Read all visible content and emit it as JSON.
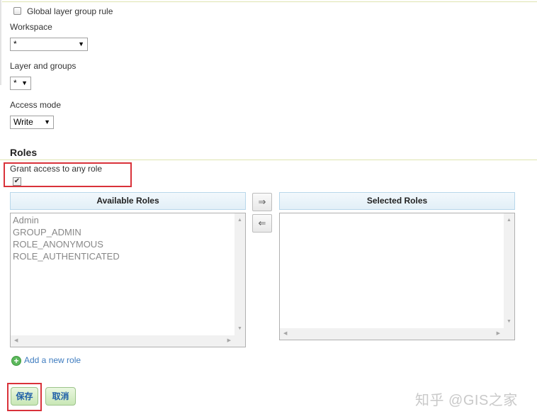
{
  "form": {
    "global_layer_group_rule_label": "Global layer group rule",
    "global_layer_group_rule_checked": false,
    "workspace_label": "Workspace",
    "workspace_value": "*",
    "layer_groups_label": "Layer and groups",
    "layer_groups_value": "*",
    "access_mode_label": "Access mode",
    "access_mode_value": "Write"
  },
  "roles": {
    "heading": "Roles",
    "grant_any_label": "Grant access to any role",
    "grant_any_checked": true,
    "available_header": "Available Roles",
    "selected_header": "Selected Roles",
    "available": [
      "Admin",
      "GROUP_ADMIN",
      "ROLE_ANONYMOUS",
      "ROLE_AUTHENTICATED"
    ],
    "selected": [],
    "move_right_glyph": "⇒",
    "move_left_glyph": "⇐",
    "add_role_label": "Add a new role"
  },
  "actions": {
    "save_label": "保存",
    "cancel_label": "取消"
  },
  "watermark": "知乎 @GIS之家",
  "colors": {
    "highlight_red": "#d9323a",
    "link_blue": "#3d7bbf",
    "button_green": "#c9e7b6",
    "header_blue": "#e2eff7"
  }
}
